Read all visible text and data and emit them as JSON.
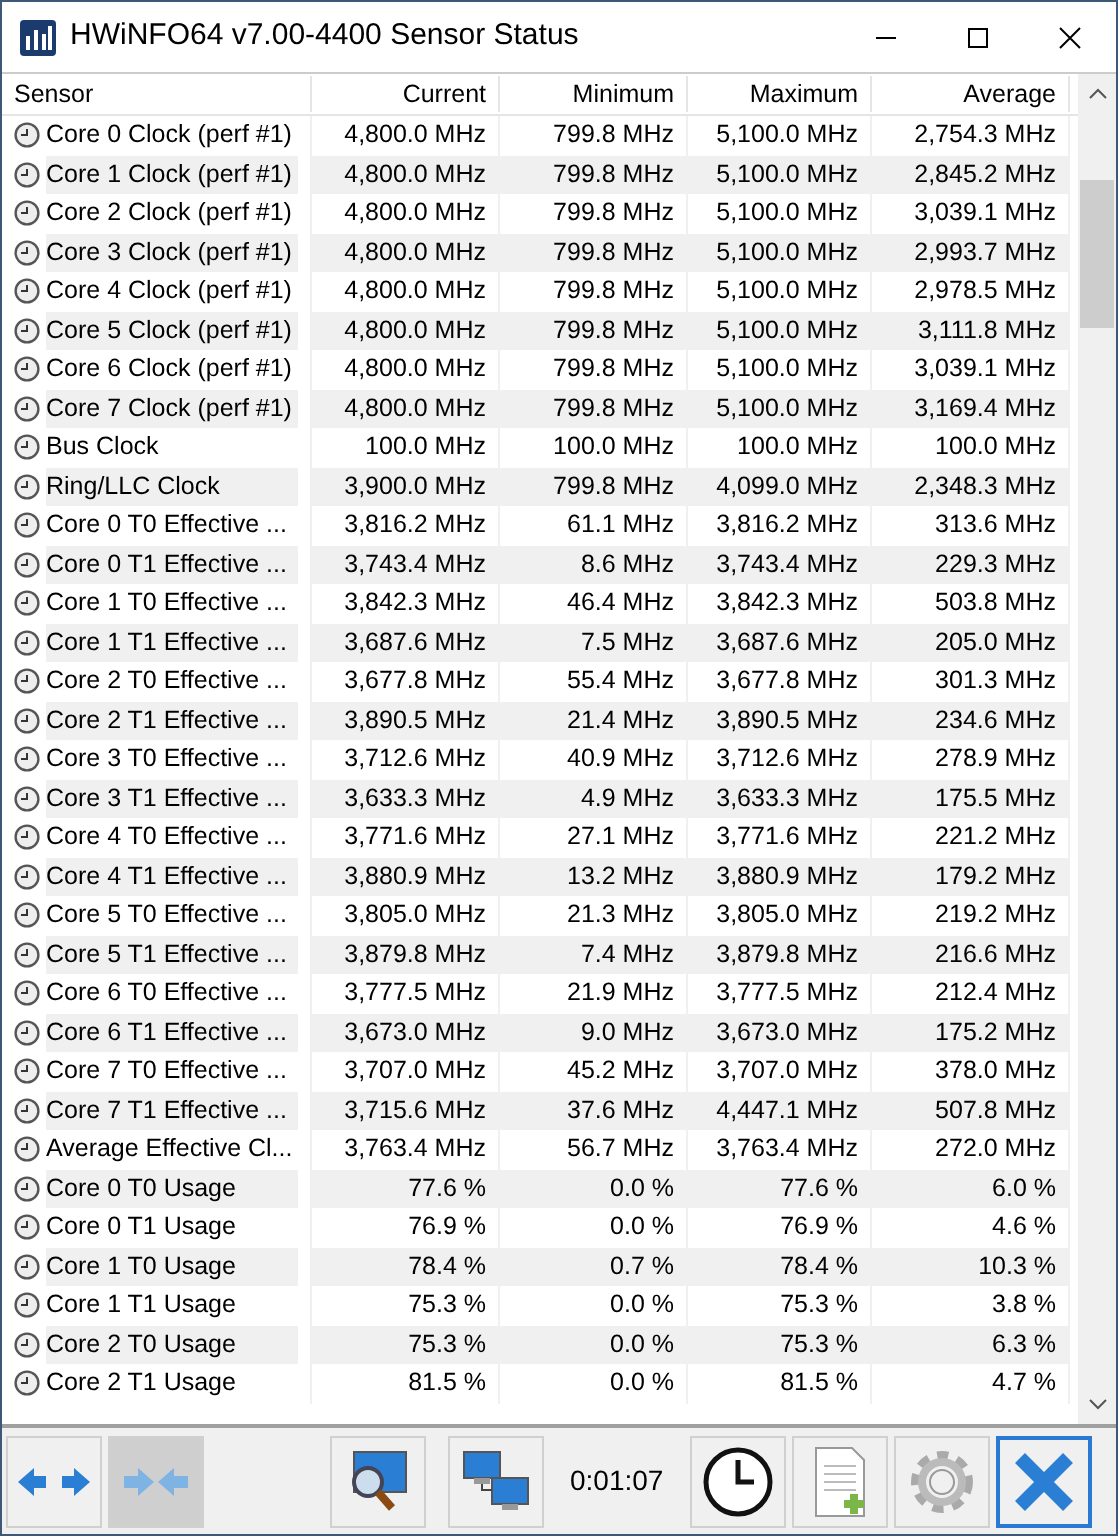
{
  "window": {
    "title": "HWiNFO64 v7.00-4400 Sensor Status"
  },
  "table": {
    "columns": [
      "Sensor",
      "Current",
      "Minimum",
      "Maximum",
      "Average"
    ],
    "rows": [
      [
        "Core 0 Clock (perf #1)",
        "4,800.0 MHz",
        "799.8 MHz",
        "5,100.0 MHz",
        "2,754.3 MHz"
      ],
      [
        "Core 1 Clock (perf #1)",
        "4,800.0 MHz",
        "799.8 MHz",
        "5,100.0 MHz",
        "2,845.2 MHz"
      ],
      [
        "Core 2 Clock (perf #1)",
        "4,800.0 MHz",
        "799.8 MHz",
        "5,100.0 MHz",
        "3,039.1 MHz"
      ],
      [
        "Core 3 Clock (perf #1)",
        "4,800.0 MHz",
        "799.8 MHz",
        "5,100.0 MHz",
        "2,993.7 MHz"
      ],
      [
        "Core 4 Clock (perf #1)",
        "4,800.0 MHz",
        "799.8 MHz",
        "5,100.0 MHz",
        "2,978.5 MHz"
      ],
      [
        "Core 5 Clock (perf #1)",
        "4,800.0 MHz",
        "799.8 MHz",
        "5,100.0 MHz",
        "3,111.8 MHz"
      ],
      [
        "Core 6 Clock (perf #1)",
        "4,800.0 MHz",
        "799.8 MHz",
        "5,100.0 MHz",
        "3,039.1 MHz"
      ],
      [
        "Core 7 Clock (perf #1)",
        "4,800.0 MHz",
        "799.8 MHz",
        "5,100.0 MHz",
        "3,169.4 MHz"
      ],
      [
        "Bus Clock",
        "100.0 MHz",
        "100.0 MHz",
        "100.0 MHz",
        "100.0 MHz"
      ],
      [
        "Ring/LLC Clock",
        "3,900.0 MHz",
        "799.8 MHz",
        "4,099.0 MHz",
        "2,348.3 MHz"
      ],
      [
        "Core 0 T0 Effective ...",
        "3,816.2 MHz",
        "61.1 MHz",
        "3,816.2 MHz",
        "313.6 MHz"
      ],
      [
        "Core 0 T1 Effective ...",
        "3,743.4 MHz",
        "8.6 MHz",
        "3,743.4 MHz",
        "229.3 MHz"
      ],
      [
        "Core 1 T0 Effective ...",
        "3,842.3 MHz",
        "46.4 MHz",
        "3,842.3 MHz",
        "503.8 MHz"
      ],
      [
        "Core 1 T1 Effective ...",
        "3,687.6 MHz",
        "7.5 MHz",
        "3,687.6 MHz",
        "205.0 MHz"
      ],
      [
        "Core 2 T0 Effective ...",
        "3,677.8 MHz",
        "55.4 MHz",
        "3,677.8 MHz",
        "301.3 MHz"
      ],
      [
        "Core 2 T1 Effective ...",
        "3,890.5 MHz",
        "21.4 MHz",
        "3,890.5 MHz",
        "234.6 MHz"
      ],
      [
        "Core 3 T0 Effective ...",
        "3,712.6 MHz",
        "40.9 MHz",
        "3,712.6 MHz",
        "278.9 MHz"
      ],
      [
        "Core 3 T1 Effective ...",
        "3,633.3 MHz",
        "4.9 MHz",
        "3,633.3 MHz",
        "175.5 MHz"
      ],
      [
        "Core 4 T0 Effective ...",
        "3,771.6 MHz",
        "27.1 MHz",
        "3,771.6 MHz",
        "221.2 MHz"
      ],
      [
        "Core 4 T1 Effective ...",
        "3,880.9 MHz",
        "13.2 MHz",
        "3,880.9 MHz",
        "179.2 MHz"
      ],
      [
        "Core 5 T0 Effective ...",
        "3,805.0 MHz",
        "21.3 MHz",
        "3,805.0 MHz",
        "219.2 MHz"
      ],
      [
        "Core 5 T1 Effective ...",
        "3,879.8 MHz",
        "7.4 MHz",
        "3,879.8 MHz",
        "216.6 MHz"
      ],
      [
        "Core 6 T0 Effective ...",
        "3,777.5 MHz",
        "21.9 MHz",
        "3,777.5 MHz",
        "212.4 MHz"
      ],
      [
        "Core 6 T1 Effective ...",
        "3,673.0 MHz",
        "9.0 MHz",
        "3,673.0 MHz",
        "175.2 MHz"
      ],
      [
        "Core 7 T0 Effective ...",
        "3,707.0 MHz",
        "45.2 MHz",
        "3,707.0 MHz",
        "378.0 MHz"
      ],
      [
        "Core 7 T1 Effective ...",
        "3,715.6 MHz",
        "37.6 MHz",
        "4,447.1 MHz",
        "507.8 MHz"
      ],
      [
        "Average Effective Cl...",
        "3,763.4 MHz",
        "56.7 MHz",
        "3,763.4 MHz",
        "272.0 MHz"
      ],
      [
        "Core 0 T0 Usage",
        "77.6 %",
        "0.0 %",
        "77.6 %",
        "6.0 %"
      ],
      [
        "Core 0 T1 Usage",
        "76.9 %",
        "0.0 %",
        "76.9 %",
        "4.6 %"
      ],
      [
        "Core 1 T0 Usage",
        "78.4 %",
        "0.7 %",
        "78.4 %",
        "10.3 %"
      ],
      [
        "Core 1 T1 Usage",
        "75.3 %",
        "0.0 %",
        "75.3 %",
        "3.8 %"
      ],
      [
        "Core 2 T0 Usage",
        "75.3 %",
        "0.0 %",
        "75.3 %",
        "6.3 %"
      ],
      [
        "Core 2 T1 Usage",
        "81.5 %",
        "0.0 %",
        "81.5 %",
        "4.7 %"
      ]
    ]
  },
  "toolbar": {
    "buttons": [
      {
        "kind": "expand",
        "pressed": false
      },
      {
        "kind": "collapse",
        "pressed": true
      },
      {
        "kind": "search"
      },
      {
        "kind": "network"
      },
      {
        "kind": "timer",
        "label": "0:01:07"
      },
      {
        "kind": "clock"
      },
      {
        "kind": "report"
      },
      {
        "kind": "settings"
      },
      {
        "kind": "close",
        "focused": true
      }
    ]
  }
}
